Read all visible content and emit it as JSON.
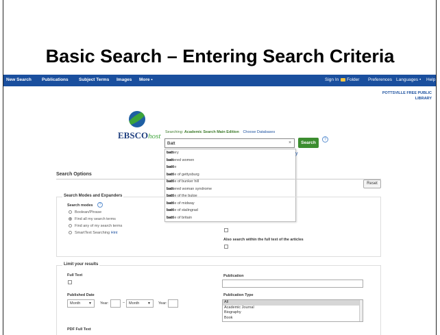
{
  "slide": {
    "title": "Basic Search – Entering Search Criteria"
  },
  "topnav": {
    "left": [
      "New Search",
      "Publications",
      "Subject Terms",
      "Images",
      "More •"
    ],
    "right": [
      "Sign In",
      "Folder",
      "Preferences",
      "Languages •",
      "Help"
    ]
  },
  "library": {
    "line1": "POTTSVILLE FREE PUBLIC",
    "line2": "LIBRARY"
  },
  "logo": {
    "main": "EBSCO",
    "suffix": "host"
  },
  "searching": {
    "label": "Searching:",
    "database": "Academic Search Main Edition",
    "choose": "Choose Databases"
  },
  "search": {
    "value": "Batt",
    "button": "Search",
    "help": "?"
  },
  "suggestions": [
    {
      "bold": "batt",
      "rest": "ery"
    },
    {
      "bold": "batt",
      "rest": "ered women"
    },
    {
      "bold": "batt",
      "rest": "le"
    },
    {
      "bold": "batt",
      "rest": "le of gettysburg"
    },
    {
      "bold": "batt",
      "rest": "le of bunker hill"
    },
    {
      "bold": "batt",
      "rest": "ered woman syndrome"
    },
    {
      "bold": "batt",
      "rest": "le of the bulge"
    },
    {
      "bold": "batt",
      "rest": "le of midway"
    },
    {
      "bold": "batt",
      "rest": "le of stalingrad"
    },
    {
      "bold": "batt",
      "rest": "le of britain"
    }
  ],
  "stray_y": "y",
  "search_options": {
    "title": "Search Options",
    "reset": "Reset",
    "modes_title": "Search Modes and Expanders",
    "modes_label": "Search modes",
    "modes": [
      "Boolean/Phrase",
      "Find all my search terms",
      "Find any of my search terms",
      "SmartText Searching"
    ],
    "hint": "Hint",
    "full_text_expander": "Also search within the full text of the articles"
  },
  "limits": {
    "title": "Limit your results",
    "full_text": "Full Text",
    "publication": "Publication",
    "published_date": "Published Date",
    "month1": "Month",
    "year1": "Year:",
    "dash": "–",
    "month2": "Month",
    "year2": "Year:",
    "publication_type": "Publication Type",
    "pub_types": [
      "All",
      "Academic Journal",
      "Biography",
      "Book"
    ],
    "pdf_full_text": "PDF Full Text"
  }
}
